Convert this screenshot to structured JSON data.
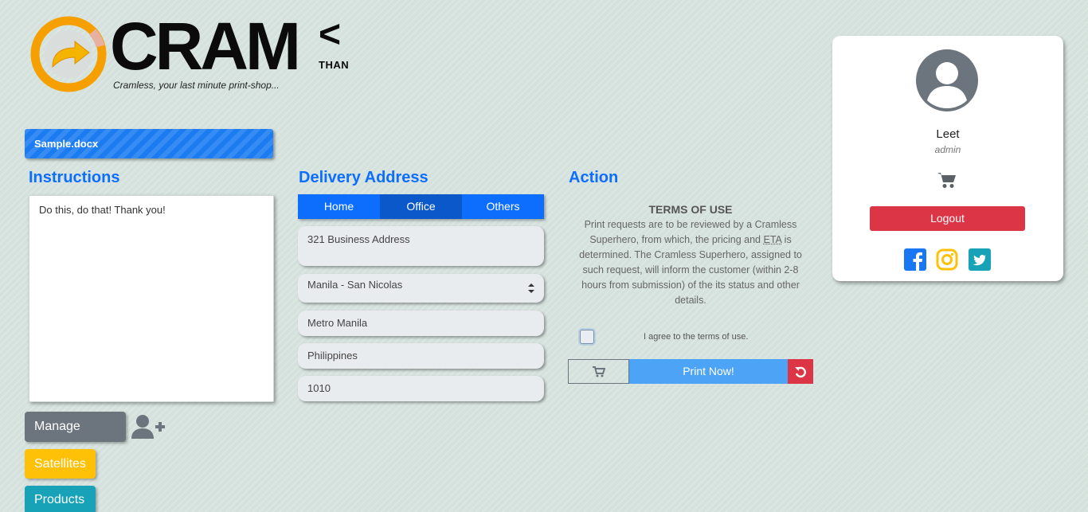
{
  "brand": {
    "name": "CRAM",
    "lt_symbol": "<",
    "than": "THAN",
    "tagline": "Cramless, your last minute print-shop...",
    "primary_color": "#0d6efd"
  },
  "file": {
    "name": "Sample.docx"
  },
  "instructions": {
    "title": "Instructions",
    "text": "Do this, do that! Thank you!"
  },
  "admin": {
    "manage_users": "Manage Users",
    "satellites": "Satellites",
    "products": "Products"
  },
  "delivery": {
    "title": "Delivery Address",
    "tabs": [
      {
        "label": "Home",
        "active": false
      },
      {
        "label": "Office",
        "active": true
      },
      {
        "label": "Others",
        "active": false
      }
    ],
    "address": "321 Business Address",
    "city": "Manila - San Nicolas",
    "region": "Metro Manila",
    "country": "Philippines",
    "zip": "1010"
  },
  "action": {
    "title": "Action",
    "terms_title": "TERMS OF USE",
    "terms_text_1": "Print requests are to be reviewed by a Cramless Superhero, from which, the pricing and ",
    "terms_eta": "ETA",
    "terms_text_2": " is determined. The Cramless Superhero, assigned to such request, will inform the customer (within 2-8 hours from submission) of the its status and other details.",
    "agree_label": "I agree to the terms of use.",
    "agree_checked": false,
    "print_label": "Print Now!"
  },
  "profile": {
    "name": "Leet",
    "role": "admin",
    "logout_label": "Logout",
    "social_icons": [
      "facebook-icon",
      "instagram-icon",
      "twitter-icon"
    ]
  }
}
